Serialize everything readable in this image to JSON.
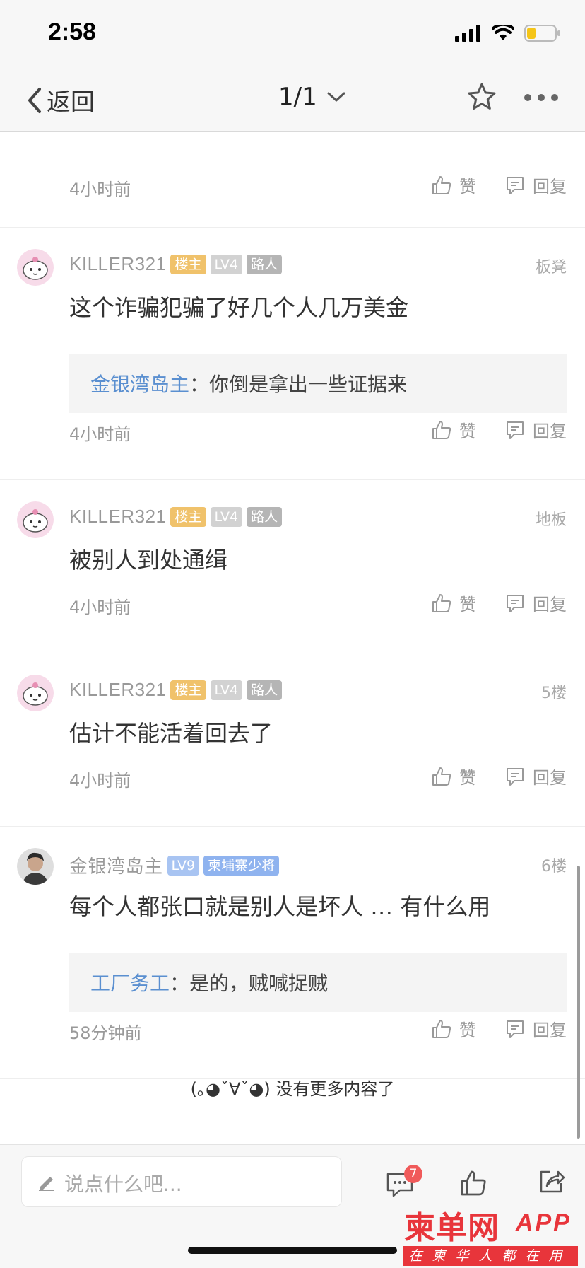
{
  "status": {
    "time": "2:58"
  },
  "nav": {
    "back_label": "返回",
    "pager": "1/1"
  },
  "first_post": {
    "time": "4小时前",
    "like": "赞",
    "reply": "回复"
  },
  "posts": [
    {
      "user": "KILLER321",
      "badge1": "楼主",
      "badge2": "LV4",
      "badge3": "路人",
      "floor": "板凳",
      "content": "这个诈骗犯骗了好几个人几万美金",
      "quote_name": "金银湾岛主",
      "quote_text": "你倒是拿出一些证据来",
      "time": "4小时前",
      "like": "赞",
      "reply": "回复"
    },
    {
      "user": "KILLER321",
      "badge1": "楼主",
      "badge2": "LV4",
      "badge3": "路人",
      "floor": "地板",
      "content": "被别人到处通缉",
      "time": "4小时前",
      "like": "赞",
      "reply": "回复"
    },
    {
      "user": "KILLER321",
      "badge1": "楼主",
      "badge2": "LV4",
      "badge3": "路人",
      "floor": "5楼",
      "content": "估计不能活着回去了",
      "time": "4小时前",
      "like": "赞",
      "reply": "回复"
    },
    {
      "user": "金银湾岛主",
      "badge1": "LV9",
      "badge2": "柬埔寨少将",
      "floor": "6楼",
      "content": "每个人都张口就是别人是坏人 … 有什么用",
      "quote_name": "工厂务工",
      "quote_text": "是的，贼喊捉贼",
      "time": "58分钟前",
      "like": "赞",
      "reply": "回复"
    }
  ],
  "no_more": "(｡◕ˇ∀ˇ◕) 没有更多内容了",
  "bottom": {
    "placeholder": "说点什么吧...",
    "comment_count": "7"
  },
  "watermark": {
    "title": "柬单网",
    "app": "APP",
    "sub": "在柬华人都在用"
  },
  "colors": {
    "accent_blue": "#5a8fd0",
    "badge_owner": "#f0c26b",
    "watermark_red": "#e8353b"
  }
}
